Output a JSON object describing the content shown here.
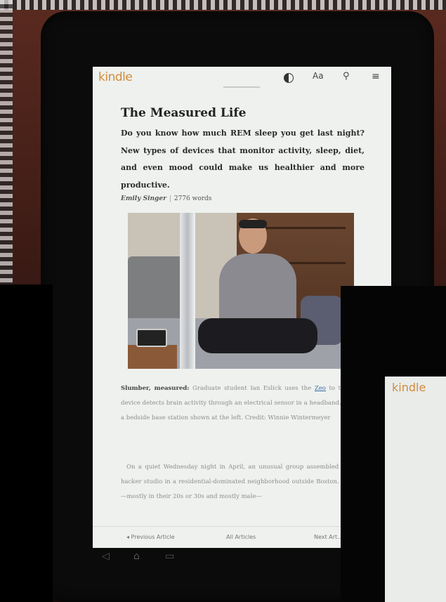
{
  "app": {
    "logo": "kindle",
    "secondary_logo": "kindle",
    "accent_color": "#d28a3c"
  },
  "toolbar": {
    "icons": [
      "contrast-icon",
      "font-size-icon",
      "search-icon",
      "menu-icon"
    ],
    "font_label": "Aa",
    "search_glyph": "⚲",
    "menu_glyph": "≡"
  },
  "article": {
    "title": "The Measured Life",
    "dek": "Do you know how much REM sleep you get last night? New types of devices that monitor activity, sleep, diet, and even mood could make us healthier and more productive.",
    "author": "Emily Singer",
    "word_count": "2776 words"
  },
  "caption": {
    "lead": "Slumber, measured:",
    "text_before_link": "Graduate student Ian Eslick uses the",
    "link": "Zeo",
    "text_after_link": "to track his sleep. The device detects brain activity through an electrical sensor in a headband. That data is sent to a bedside base station shown at the left. Credit: Winnie Wintermeyer"
  },
  "body": {
    "paragraph": "On a quiet Wednesday night in April, an unusual group assembled in a garage turned hacker studio in a residential-dominated neighborhood outside Boston. They gathered here—mostly in their 20s or 30s and mostly male—"
  },
  "bottom_bar": {
    "prev": "◂ Previous Article",
    "all": "All Articles",
    "next": "Next Art..."
  },
  "softkeys": {
    "back": "◁",
    "home": "⌂",
    "recent": "▭"
  }
}
